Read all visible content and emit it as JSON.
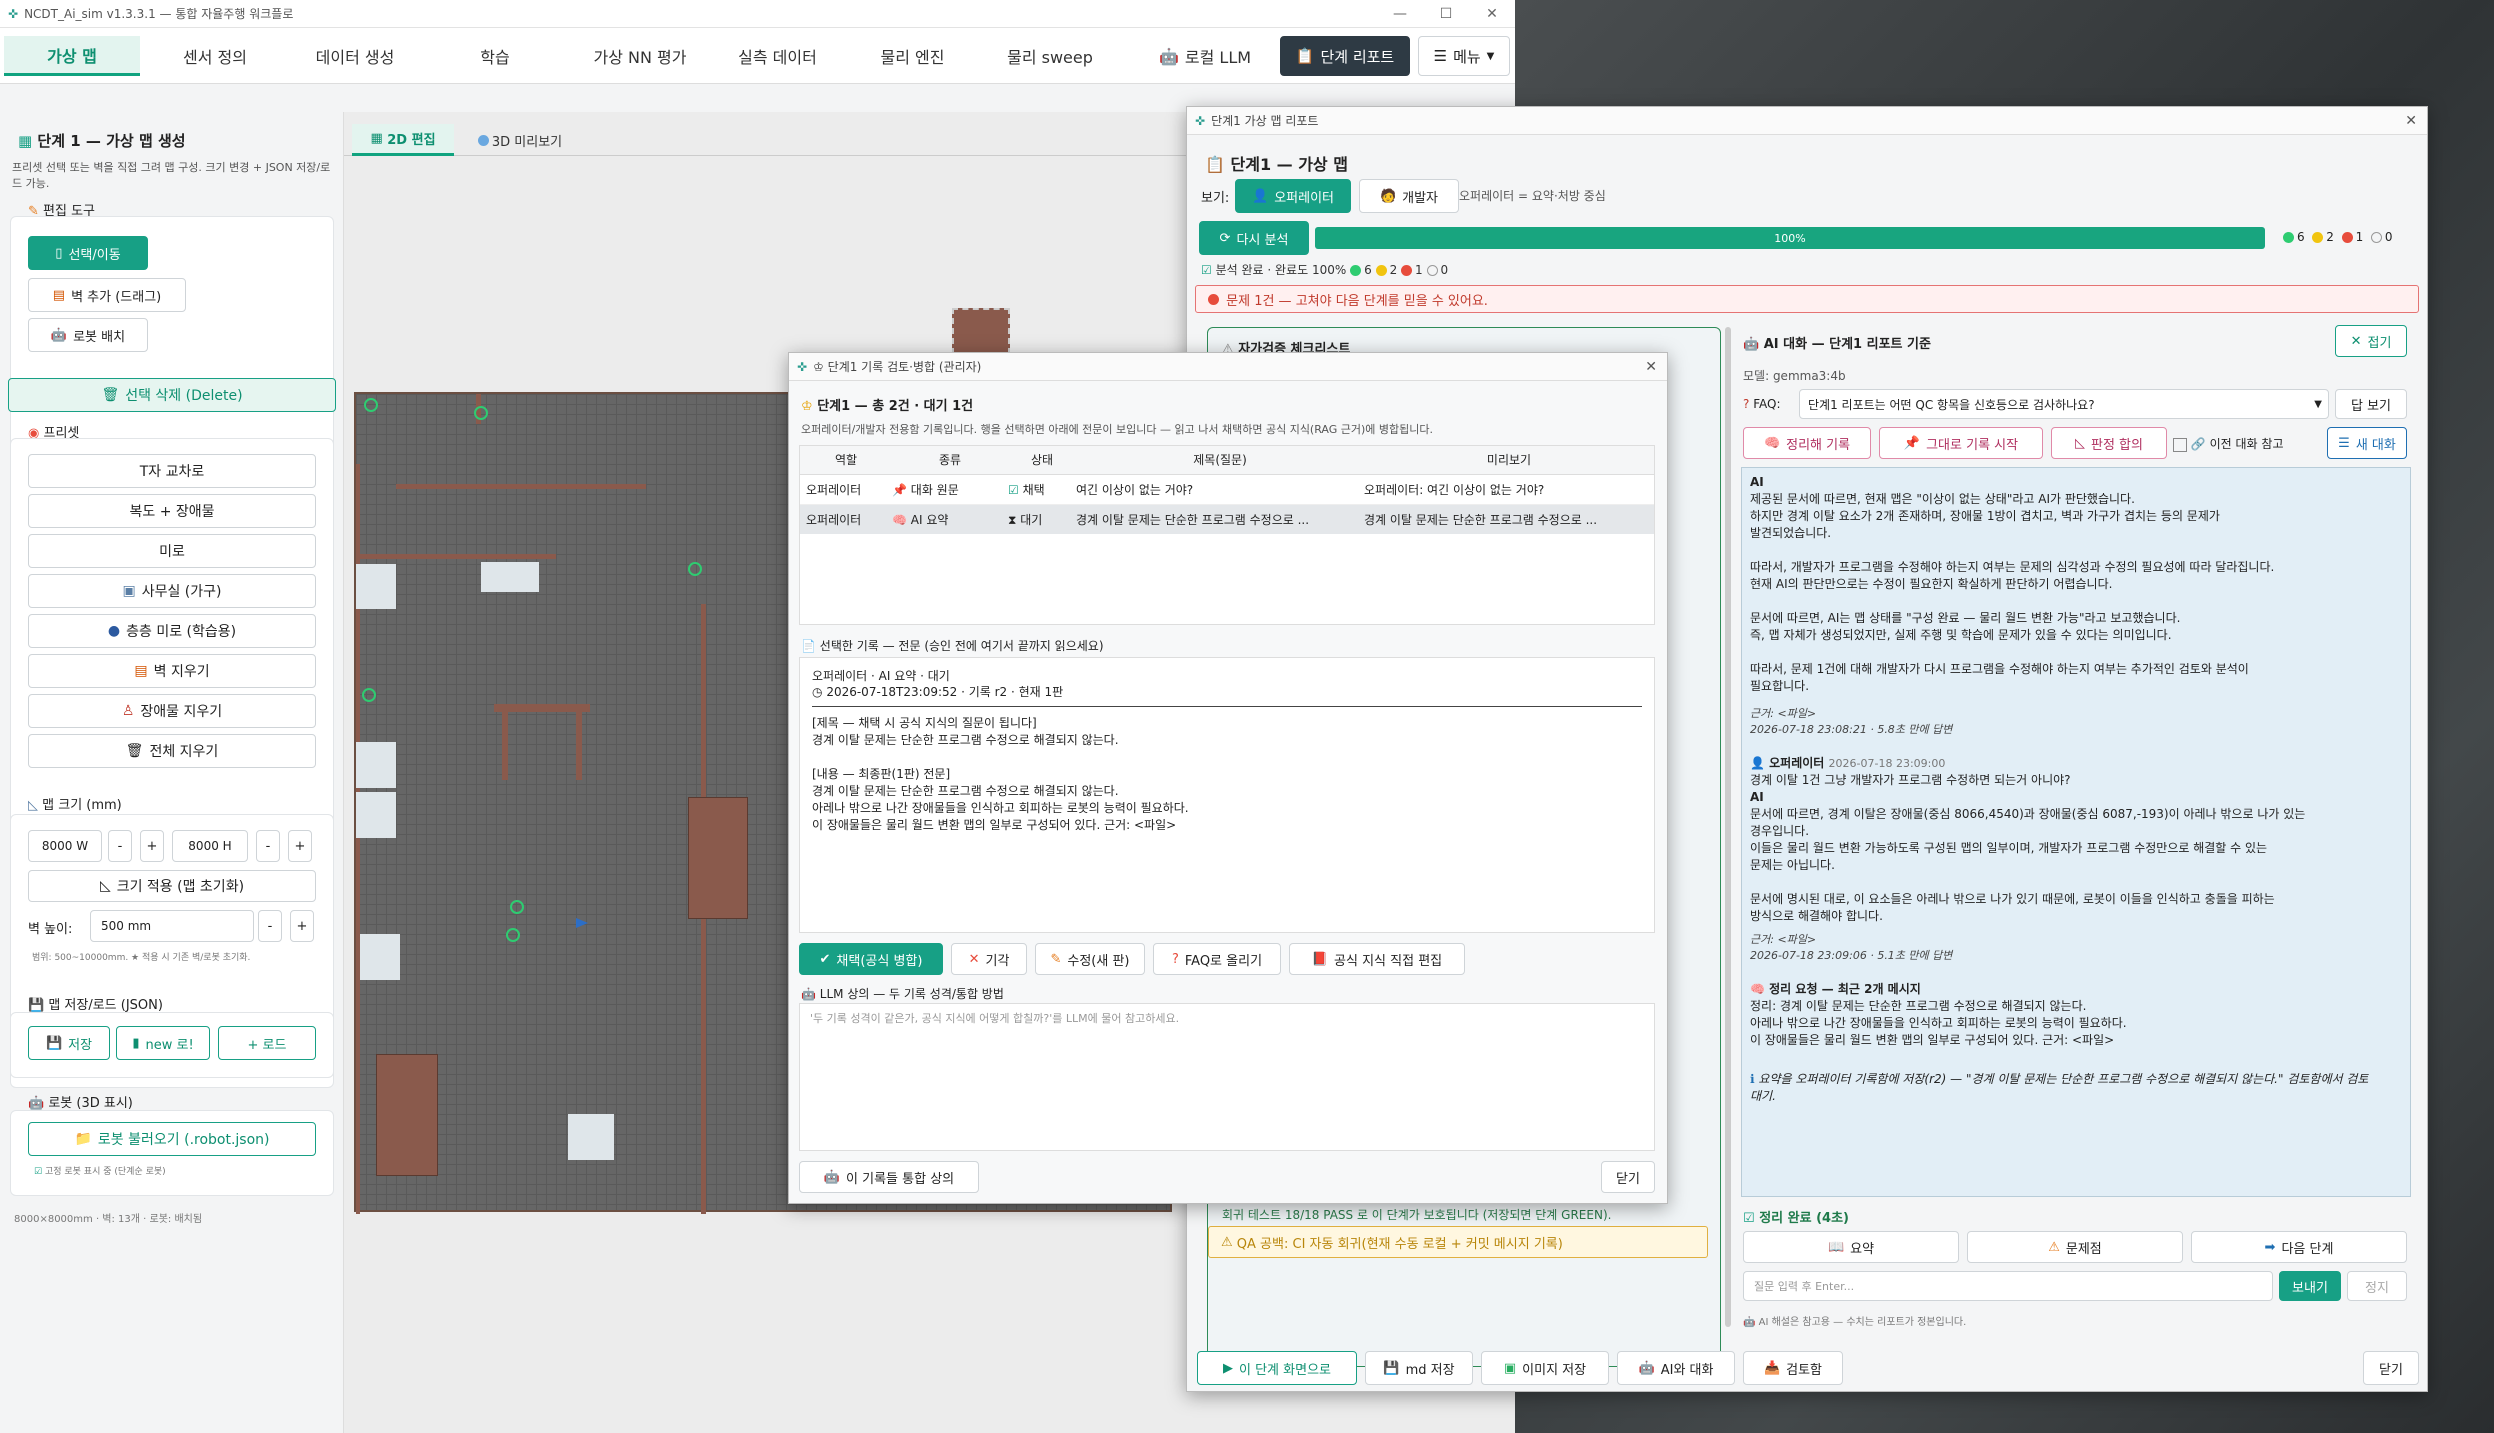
{
  "app": {
    "title": "NCDT_Ai_sim v1.3.3.1 — 통합 자율주행 워크플로",
    "min": "—",
    "max": "☐",
    "close": "✕"
  },
  "nav": {
    "tabs": [
      "가상 맵",
      "센서 정의",
      "데이터 생성",
      "학습",
      "가상 NN 평가",
      "실측 데이터",
      "물리 엔진",
      "물리 sweep",
      "로컬 LLM"
    ],
    "report_btn": "단계 리포트",
    "menu_btn": "메뉴"
  },
  "left": {
    "title": "단계 1 — 가상 맵 생성",
    "desc": "프리셋 선택 또는 벽을 직접 그려 맵 구성. 크기 변경 + JSON 저장/로드 가능.",
    "edit_tools_label": "편집 도구",
    "tool_select": "선택/이동",
    "tool_wall": "벽 추가 (드래그)",
    "tool_robot": "로봇 배치",
    "delete_btn": "선택 삭제 (Delete)",
    "preset_label": "프리셋",
    "presets": [
      "T자 교차로",
      "복도 + 장애물",
      "미로",
      "사무실 (가구)",
      "층층 미로 (학습용)",
      "벽 지우기",
      "장애물 지우기",
      "전체 지우기"
    ],
    "map_size_label": "맵 크기 (mm)",
    "width_val": "8000 W",
    "height_val": "8000 H",
    "minus": "-",
    "plus": "+",
    "apply_btn": "크기 적용 (맵 초기화)",
    "wall_height_label": "벽 높이:",
    "wall_height_val": "500 mm",
    "range_hint": "범위: 500~10000mm. ★ 적용 시 기존 벽/로봇 초기화.",
    "saveload_label": "맵 저장/로드 (JSON)",
    "save_btn": "저장",
    "new_btn": "new 로!",
    "load_btn": "+ 로드",
    "robot_label": "로봇 (3D 표시)",
    "robot_load_btn": "로봇 불러오기 (.robot.json)",
    "robot_hint": "고정 로봇 표시 중 (단계순 로봇)",
    "status": "8000×8000mm · 벽: 13개 · 로봇: 배치됨"
  },
  "view_tabs": {
    "t2d": "2D 편집",
    "t3d": "3D 미리보기"
  },
  "report": {
    "window_title": "단계1 가상 맵 리포트",
    "heading": "단계1 — 가상 맵",
    "view_label": "보기:",
    "operator_btn": "오퍼레이터",
    "developer_btn": "개발자",
    "view_hint": "오퍼레이터 = 요약·처방 중심",
    "reanalyze_btn": "다시 분석",
    "progress": {
      "value": 100,
      "label": "100%"
    },
    "counts": {
      "green": "6",
      "yellow": "2",
      "red": "1",
      "empty": "0"
    },
    "analysis_done": "분석 완료 · 완료도 100%",
    "problem_banner": "문제 1건 — 고쳐야 다음 단계를 믿을 수 있어요.",
    "checklist_title": "자가검증 체크리스트",
    "qa_line1": "회귀 테스트 18/18 PASS 로 이 단계가 보호됩니다 (저장되면 단계 GREEN).",
    "qa_line2": "QA 공백: CI 자동 회귀(현재 수동 로컬 + 커밋 메시지 기록)",
    "bottom": [
      "이 단계 화면으로",
      "md 저장",
      "이미지 저장",
      "AI와 대화",
      "검토함"
    ],
    "close_btn": "닫기",
    "chat": {
      "title": "AI 대화 — 단계1 리포트 기준",
      "collapse_btn": "접기",
      "model": "모델: gemma3:4b",
      "faq_label": "FAQ:",
      "faq_value": "단계1 리포트는 어떤 QC 항목을 신호등으로 검사하나요?",
      "answer_btn": "답 보기",
      "btns": [
        "정리해 기록",
        "그대로 기록 시작",
        "판정 합의"
      ],
      "prev_ref": "이전 대화 참고",
      "new_chat": "새 대화",
      "messages": [
        "AI",
        "제공된 문서에 따르면, 현재 맵은 \"이상이 없는 상태\"라고 AI가 판단했습니다.",
        "하지만 경계 이탈 요소가 2개 존재하며, 장애물 1방이 겹치고, 벽과 가구가 겹치는 등의 문제가",
        "발견되었습니다.",
        "",
        "따라서, 개발자가 프로그램을 수정해야 하는지 여부는 문제의 심각성과 수정의 필요성에 따라 달라집니다.",
        "현재 AI의 판단만으로는 수정이 필요한지 확실하게 판단하기 어렵습니다.",
        "",
        "문서에 따르면, AI는 맵 상태를 \"구성 완료 — 물리 월드 변환 가능\"라고 보고했습니다.",
        "즉, 맵 자체가 생성되었지만, 실제 주행 및 학습에 문제가 있을 수 있다는 의미입니다.",
        "",
        "따라서, 문제 1건에 대해 개발자가 다시 프로그램을 수정해야 하는지 여부는 추가적인 검토와 분석이",
        "필요합니다."
      ],
      "ref1": "근거: <파일>",
      "meta1": "2026-07-18 23:08:21 · 5.8초 만에 답변",
      "q2_who": "오퍼레이터",
      "q2_time": "2026-07-18 23:09:00",
      "q2": "경계 이탈 1건 그냥 개발자가 프로그램 수정하면 되는거 아니야?",
      "a2": [
        "AI",
        "문서에 따르면, 경계 이탈은 장애물(중심 8066,4540)과 장애물(중심 6087,-193)이 아레나 밖으로 나가 있는",
        "경우입니다.",
        "이들은 물리 월드 변환 가능하도록 구성된 맵의 일부이며, 개발자가 프로그램 수정만으로 해결할 수 있는",
        "문제는 아닙니다.",
        "",
        "문서에 명시된 대로, 이 요소들은 아레나 밖으로 나가 있기 때문에, 로봇이 이들을 인식하고 충돌을 피하는",
        "방식으로 해결해야 합니다."
      ],
      "ref2": "근거: <파일>",
      "meta2": "2026-07-18 23:09:06 · 5.1초 만에 답변",
      "sum_title": "정리 요청 — 최근 2개 메시지",
      "sum": [
        "정리: 경계 이탈 문제는 단순한 프로그램 수정으로 해결되지 않는다.",
        "아레나 밖으로 나간 장애물들을 인식하고 회피하는 로봇의 능력이 필요하다.",
        "이 장애물들은 물리 월드 변환 맵의 일부로 구성되어 있다. 근거: <파일>"
      ],
      "saved_note": "요약을 오퍼레이터 기록함에 저장(r2) — \"경계 이탈 문제는 단순한 프로그램 수정으로 해결되지 않는다.\" 검토함에서 검토 대기.",
      "done": "정리 완료 (4초)",
      "action_btns": [
        "요약",
        "문제점",
        "다음 단계"
      ],
      "input_placeholder": "질문 입력 후 Enter...",
      "send_btn": "보내기",
      "stop_btn": "정지",
      "footer": "AI 해설은 참고용 — 수치는 리포트가 정본입니다."
    }
  },
  "review": {
    "window_title": "단계1 기록 검토·병합 (관리자)",
    "heading": "단계1 — 총 2건 · 대기 1건",
    "desc": "오퍼레이터/개발자 전용함 기록입니다. 행을 선택하면 아래에 전문이 보입니다 — 읽고 나서 채택하면 공식 지식(RAG 근거)에 병합됩니다.",
    "columns": [
      "역할",
      "종류",
      "상태",
      "제목(질문)",
      "미리보기"
    ],
    "rows": [
      {
        "role": "오퍼레이터",
        "kind": "대화 원문",
        "status": "채택",
        "title": "여긴 이상이 없는 거야?",
        "preview": "오퍼레이터: 여긴 이상이 없는 거야?"
      },
      {
        "role": "오퍼레이터",
        "kind": "AI 요약",
        "status": "대기",
        "title": "경계 이탈 문제는 단순한 프로그램 수정으로 ...",
        "preview": "경계 이탈 문제는 단순한 프로그램 수정으로 ..."
      }
    ],
    "detail_label": "선택한 기록 — 전문 (승인 전에 여기서 끝까지 읽으세요)",
    "detail_meta1": "오퍼레이터 · AI 요약 · 대기",
    "detail_meta2": "2026-07-18T23:09:52 · 기록 r2 · 현재 1판",
    "detail_body": [
      "[제목 — 채택 시 공식 지식의 질문이 됩니다]",
      "경계 이탈 문제는 단순한 프로그램 수정으로 해결되지 않는다.",
      "",
      "[내용 — 최종판(1판) 전문]",
      "경계 이탈 문제는 단순한 프로그램 수정으로 해결되지 않는다.",
      "아레나 밖으로 나간 장애물들을 인식하고 회피하는 로봇의 능력이 필요하다.",
      "이 장애물들은 물리 월드 변환 맵의 일부로 구성되어 있다. 근거: <파일>"
    ],
    "actions": [
      "채택(공식 병합)",
      "기각",
      "수정(새 판)",
      "FAQ로 올리기",
      "공식 지식 직접 편집"
    ],
    "llm_label": "LLM 상의 — 두 기록 성격/통합 방법",
    "llm_placeholder": "'두 기록 성격이 같은가, 공식 지식에 어떻게 합칠까?'를 LLM에 물어 참고하세요.",
    "consult_btn": "이 기록들 통합 상의",
    "close_btn": "닫기"
  }
}
